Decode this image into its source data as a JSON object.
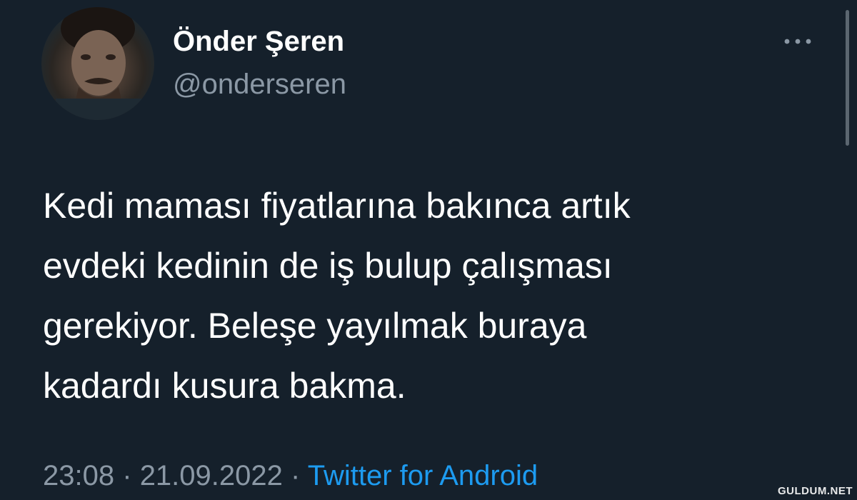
{
  "user": {
    "display_name": "Önder Şeren",
    "handle": "@onderseren"
  },
  "tweet": {
    "lines": [
      "Kedi maması fiyatlarına bakınca artık",
      "evdeki kedinin de iş bulup çalışması",
      "gerekiyor. Beleşe yayılmak buraya",
      "kadardı kusura bakma."
    ]
  },
  "meta": {
    "time": "23:08",
    "separator": "·",
    "date": "21.09.2022",
    "source": "Twitter for Android"
  },
  "icons": {
    "more": "more-dots-icon"
  },
  "colors": {
    "background": "#15202b",
    "text_primary": "#ffffff",
    "text_secondary": "#8b98a5",
    "link": "#1d9bf0"
  },
  "watermark": "GULDUM.NET"
}
